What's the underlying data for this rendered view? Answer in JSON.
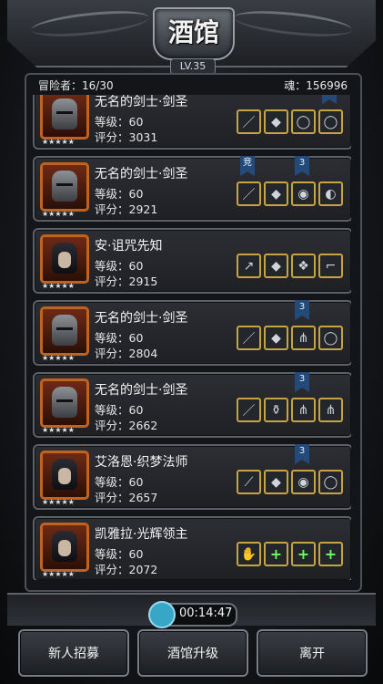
{
  "header": {
    "title": "酒馆",
    "level": "LV.35"
  },
  "stats": {
    "adventurers": "冒险者：16/30",
    "soul": "魂：156996"
  },
  "heroes": [
    {
      "name": "无名的剑士·剑圣",
      "level": "等级：60",
      "score": "评分：3031",
      "portrait": "knight",
      "stars": "★★★★★",
      "ribbons": [
        {
          "slot": 4,
          "text": ""
        }
      ],
      "equips": [
        "sword-icon",
        "armor-icon",
        "ring-icon",
        "ring-icon"
      ]
    },
    {
      "name": "无名的剑士·剑圣",
      "level": "等级：60",
      "score": "评分：2921",
      "portrait": "knight",
      "stars": "★★★★★",
      "ribbons": [
        {
          "slot": 1,
          "text": "竞"
        },
        {
          "slot": 3,
          "text": "3"
        }
      ],
      "equips": [
        "sword-icon",
        "armor-icon",
        "amulet-icon",
        "cloak-icon"
      ]
    },
    {
      "name": "安·诅咒先知",
      "level": "等级：60",
      "score": "评分：2915",
      "portrait": "hooded",
      "stars": "★★★★★",
      "ribbons": [],
      "equips": [
        "staff-icon",
        "armor-icon",
        "orb-icon",
        "boots-icon"
      ]
    },
    {
      "name": "无名的剑士·剑圣",
      "level": "等级：60",
      "score": "评分：2804",
      "portrait": "knight",
      "stars": "★★★★★",
      "ribbons": [
        {
          "slot": 3,
          "text": "3"
        }
      ],
      "equips": [
        "sword-icon",
        "armor-icon",
        "claw-icon",
        "ring-icon"
      ]
    },
    {
      "name": "无名的剑士·剑圣",
      "level": "等级：60",
      "score": "评分：2662",
      "portrait": "knight",
      "stars": "★★★★★",
      "ribbons": [
        {
          "slot": 3,
          "text": "3"
        }
      ],
      "equips": [
        "sword-icon",
        "vase-icon",
        "claw-icon",
        "claw-icon"
      ]
    },
    {
      "name": "艾洛恩·织梦法师",
      "level": "等级：60",
      "score": "评分：2657",
      "portrait": "hooded",
      "stars": "★★★★★",
      "ribbons": [
        {
          "slot": 3,
          "text": "3"
        }
      ],
      "equips": [
        "wand-icon",
        "armor-icon",
        "amulet-icon",
        "ring-icon"
      ]
    },
    {
      "name": "凯雅拉·光辉领主",
      "level": "等级：60",
      "score": "评分：2072",
      "portrait": "lady",
      "stars": "★★★★★",
      "ribbons": [],
      "equips": [
        "glove-icon",
        "add-icon",
        "add-icon",
        "add-icon"
      ]
    }
  ],
  "timer": "00:14:47",
  "buttons": {
    "recruit": "新人招募",
    "upgrade": "酒馆升级",
    "leave": "离开"
  },
  "icons": {
    "sword-icon": "／",
    "armor-icon": "◆",
    "ring-icon": "◯",
    "amulet-icon": "◉",
    "cloak-icon": "◐",
    "staff-icon": "↗",
    "orb-icon": "❖",
    "boots-icon": "⌐",
    "claw-icon": "⋔",
    "vase-icon": "⚱",
    "wand-icon": "⟋",
    "glove-icon": "✋",
    "add-icon": "+"
  }
}
